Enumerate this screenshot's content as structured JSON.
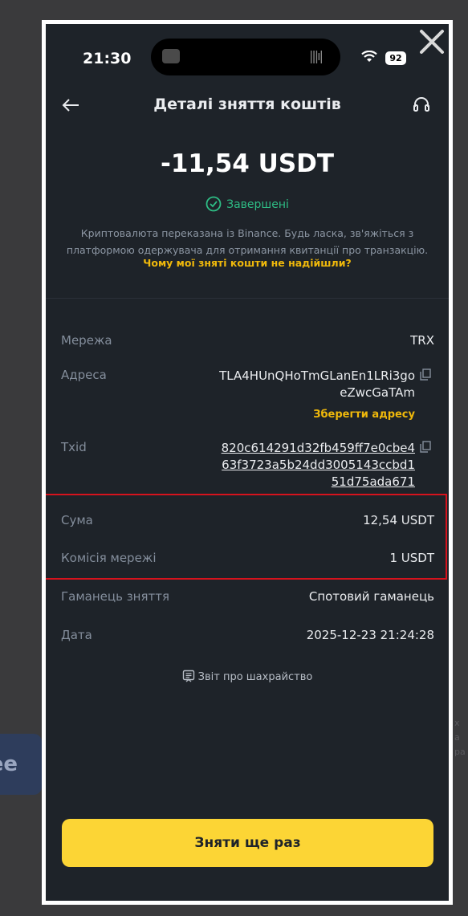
{
  "background": {
    "pill_label": "ee",
    "side_text": [
      "х",
      "а",
      "ра"
    ]
  },
  "status_bar": {
    "time": "21:30",
    "battery": "92"
  },
  "header": {
    "title": "Деталі зняття коштів"
  },
  "summary": {
    "amount": "-11,54 USDT",
    "status": "Завершені",
    "info": "Криптовалюта переказана із Binance. Будь ласка, зв'яжіться з платформою одержувача для отримання квитанції про транзакцію.",
    "why_link": "Чому мої зняті кошти не надійшли?"
  },
  "details": {
    "network": {
      "label": "Мережа",
      "value": "TRX"
    },
    "address": {
      "label": "Адреса",
      "line1": "TLA4HUnQHoTmGLanEn1LRi3go",
      "line2": "eZwcGaTAm",
      "save_label": "Зберегти адресу"
    },
    "txid": {
      "label": "Txid",
      "line1": "820c614291d32fb459ff7e0cbe4",
      "line2": "63f3723a5b24dd3005143ccbd1",
      "line3": "51d75ada671"
    },
    "sum": {
      "label": "Сума",
      "value": "12,54 USDT"
    },
    "fee": {
      "label": "Комісія мережі",
      "value": "1 USDT"
    },
    "wallet": {
      "label": "Гаманець зняття",
      "value": "Спотовий гаманець"
    },
    "date": {
      "label": "Дата",
      "value": "2025-12-23 21:24:28"
    }
  },
  "report_label": "Звіт про шахрайство",
  "withdraw_again_label": "Зняти ще раз",
  "colors": {
    "accent": "#fcd535",
    "success": "#2ebd85",
    "highlight": "#d6131d"
  }
}
